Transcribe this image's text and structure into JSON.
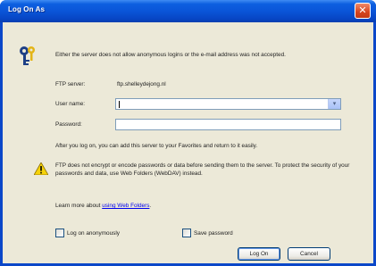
{
  "window": {
    "title": "Log On As",
    "close_glyph": "✕"
  },
  "dialog": {
    "intro_text": "Either the server does not allow anonymous logins or the e-mail address was not accepted.",
    "ftp_server_label": "FTP server:",
    "ftp_server_value": "ftp.shelleydejong.nl",
    "user_name_label": "User name:",
    "user_name_value": "",
    "password_label": "Password:",
    "password_value": "",
    "after_logon_text": "After you log on, you can add this server to your Favorites and return to it easily.",
    "warning_text": "FTP does not encrypt or encode passwords or data before sending them to the server.  To protect the security of your passwords and data, use Web Folders (WebDAV) instead.",
    "learn_more_text": "Learn more about",
    "learn_more_link": "using Web Folders",
    "learn_more_suffix": ".",
    "log_on_anonymously_label": "Log on anonymously",
    "log_on_anonymously_checked": false,
    "save_password_label": "Save password",
    "save_password_checked": false,
    "log_on_button": "Log On",
    "cancel_button": "Cancel"
  },
  "icons": {
    "key": "key-icon",
    "warning": "warning-icon",
    "dropdown": "chevron-down-icon",
    "close": "close-icon"
  },
  "colors": {
    "titlebar": "#0a55d8",
    "dialog_bg": "#ece9d8",
    "link": "#0000ee",
    "close_button": "#d6431e"
  }
}
